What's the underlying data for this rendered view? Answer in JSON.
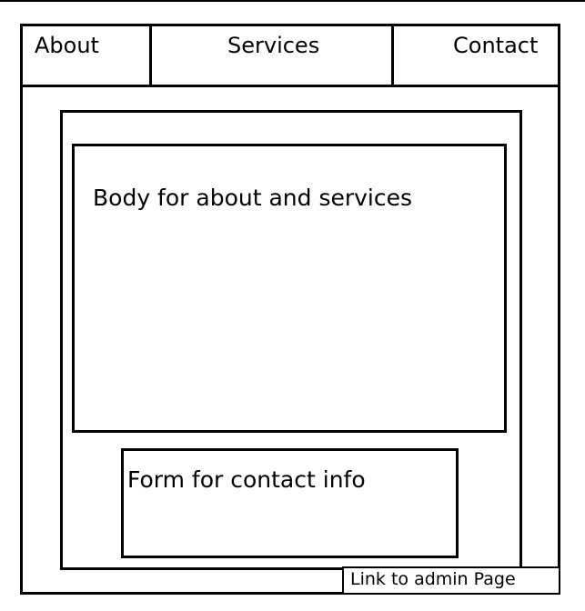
{
  "nav": {
    "about_label": "About",
    "services_label": "Services",
    "contact_label": "Contact"
  },
  "body_box": {
    "label": "Body for about and services"
  },
  "form_box": {
    "label": "Form for contact info"
  },
  "footer": {
    "admin_link_label": "Link to admin Page"
  },
  "colors": {
    "stroke": "#000000",
    "background": "#ffffff"
  }
}
